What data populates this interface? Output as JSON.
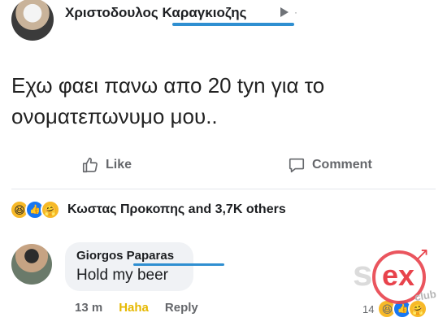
{
  "post": {
    "author": "Χριστοδουλος Καραγκιοζης",
    "separator": "·",
    "text": "Εχω φαει πανω απο 20 tyn για το\nονοματεπωνυμο μου..",
    "actions": {
      "like_label": "Like",
      "comment_label": "Comment"
    },
    "reactions": {
      "icons": [
        "haha-reaction-icon",
        "like-reaction-icon",
        "care-reaction-icon"
      ],
      "summary": "Κωστας Προκοπης and 3,7K others"
    }
  },
  "comment": {
    "author": "Giorgos Paparas",
    "text": "Hold my beer",
    "meta": {
      "time": "13 m",
      "haha_label": "Haha",
      "reply_label": "Reply"
    },
    "reaction_count": "14"
  },
  "watermark": {
    "text": "ex"
  },
  "colors": {
    "underline": "#2f8fd1",
    "secondary_text": "#65676b",
    "haha": "#e6b800",
    "watermark": "#e8434c"
  }
}
